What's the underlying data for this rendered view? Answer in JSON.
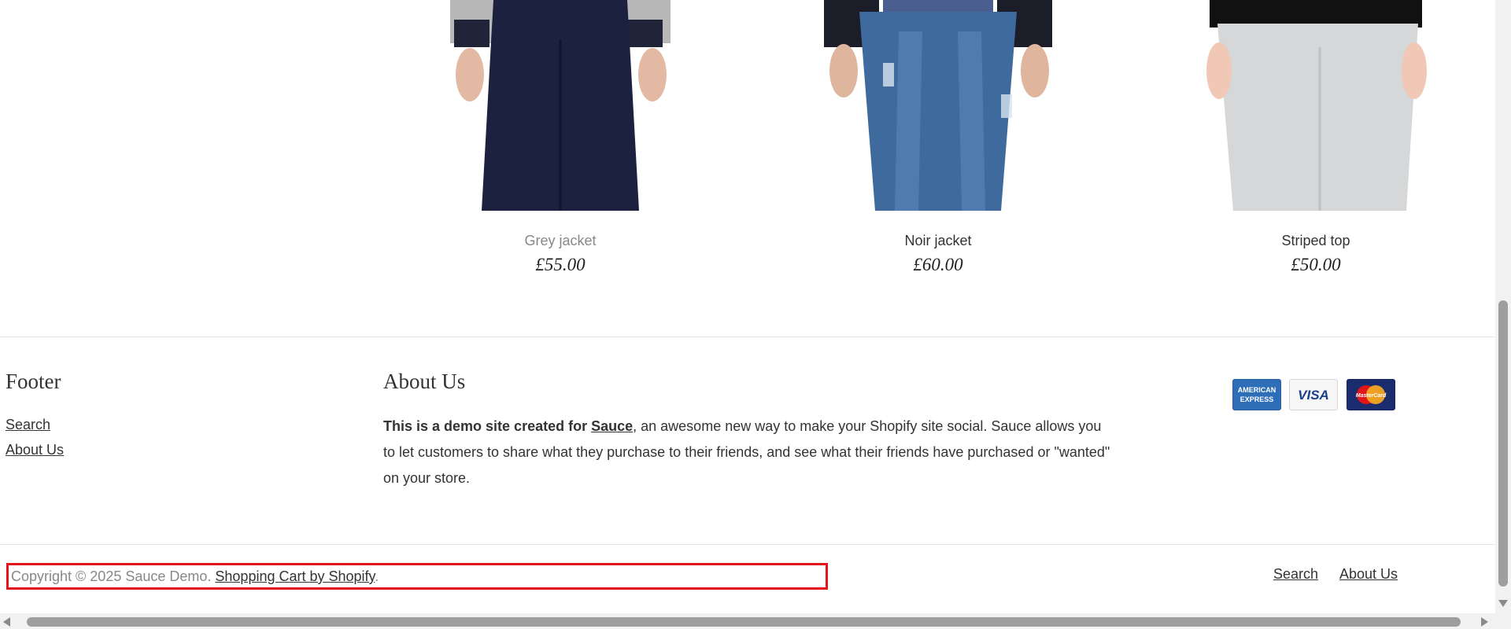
{
  "products": [
    {
      "name": "Grey jacket",
      "price": "£55.00"
    },
    {
      "name": "Noir jacket",
      "price": "£60.00"
    },
    {
      "name": "Striped top",
      "price": "£50.00"
    }
  ],
  "footer": {
    "col1_title": "Footer",
    "links": [
      "Search",
      "About Us"
    ],
    "about_title": "About Us",
    "about_bold_prefix": "This is a demo site created for ",
    "about_link": "Sauce",
    "about_rest": ", an awesome new way to make your Shopify site social. Sauce allows you to let customers to share what they purchase to their friends, and see what their friends have purchased or \"wanted\" on your store.",
    "payment_icons": [
      "american-express-icon",
      "visa-icon",
      "mastercard-icon"
    ],
    "copyright_text": "Copyright © 2025 Sauce Demo. ",
    "copyright_link": "Shopping Cart by Shopify",
    "copyright_suffix": ".",
    "bottom_links": [
      "Search",
      "About Us"
    ]
  },
  "colors": {
    "highlight": "#e3151b",
    "link": "#333333",
    "muted": "#888888"
  }
}
